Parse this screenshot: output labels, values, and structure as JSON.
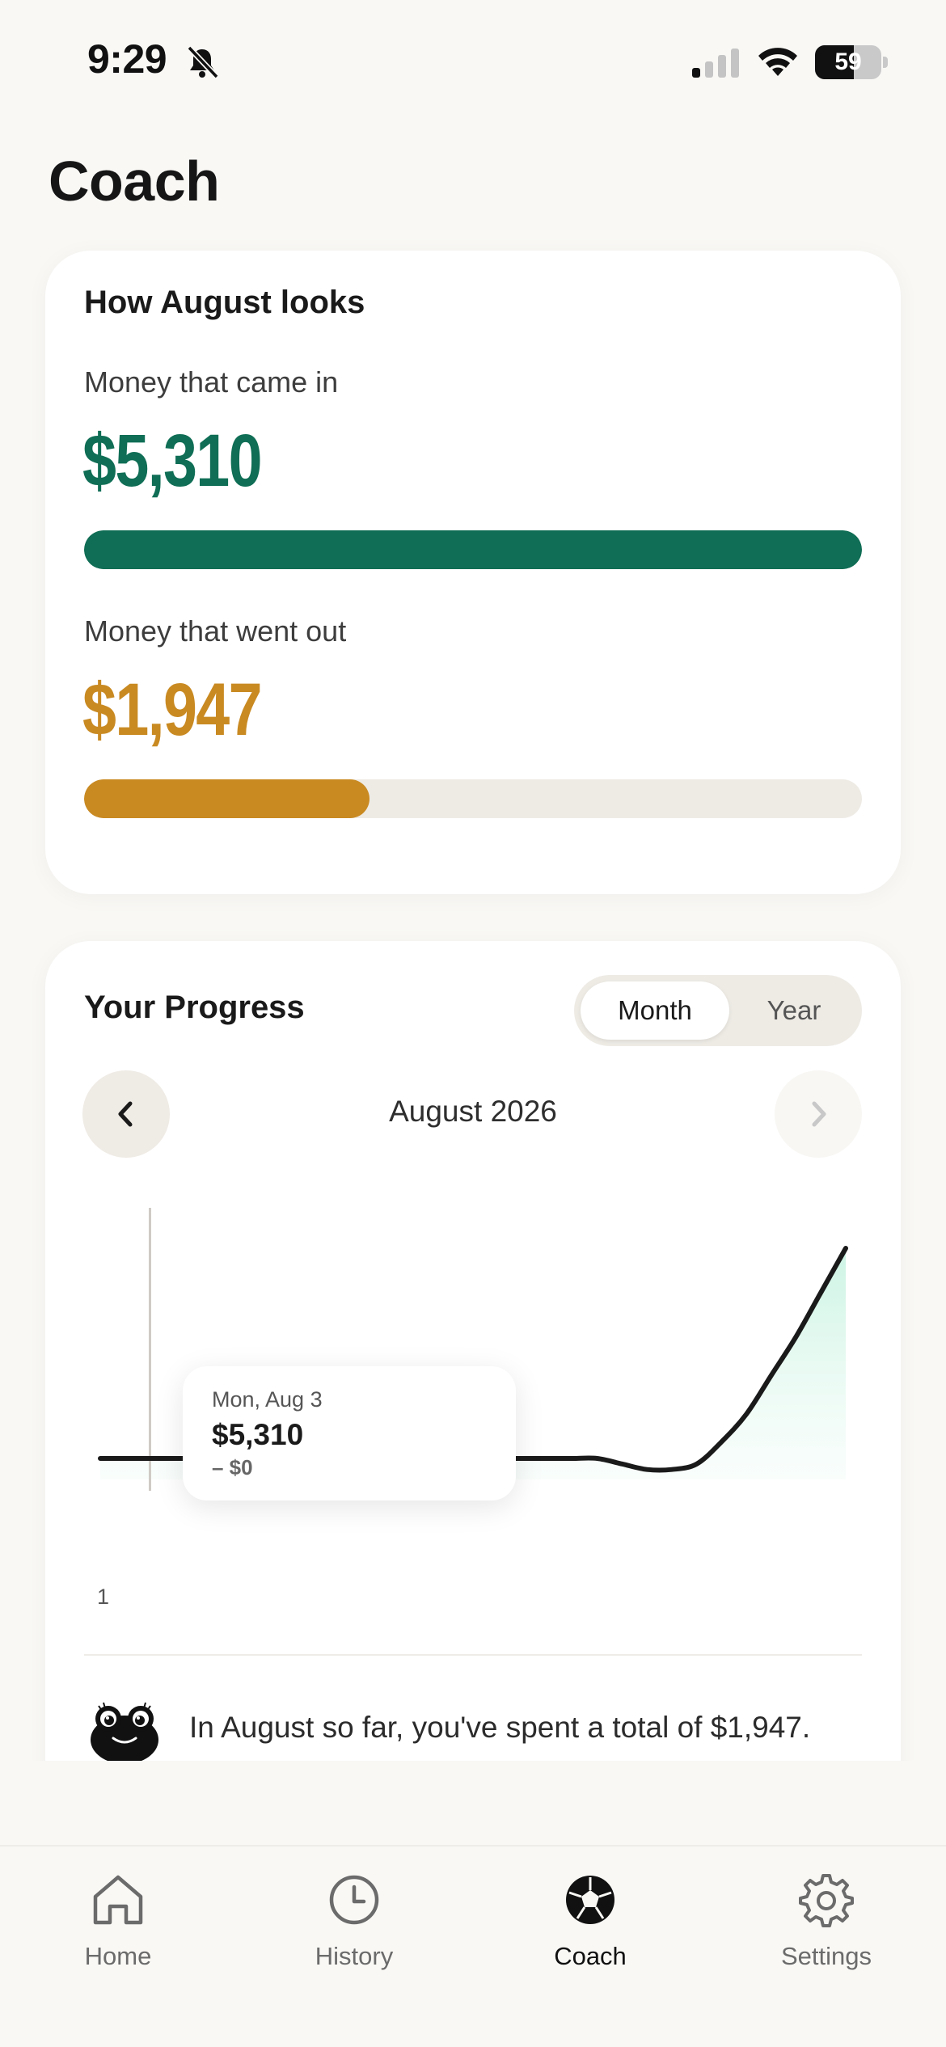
{
  "status_bar": {
    "time": "9:29",
    "battery": "59",
    "battery_level": 0.59,
    "icons": [
      "bell-slash-icon",
      "signal-icon",
      "wifi-icon",
      "battery-icon"
    ]
  },
  "page": {
    "title": "Coach"
  },
  "summary_card": {
    "title": "How August looks",
    "income": {
      "label": "Money that came in",
      "amount": "$5,310",
      "fill_fraction": 1.0,
      "color": "#0f6e55"
    },
    "spending": {
      "label": "Money that went out",
      "amount": "$1,947",
      "fill_fraction": 0.367,
      "color": "#c98a22"
    },
    "track_color": "#eeebe5"
  },
  "progress_card": {
    "title": "Your Progress",
    "segmented": {
      "options": [
        "Month",
        "Year"
      ],
      "selected": "Month"
    },
    "period": "August 2026",
    "prev_icon": "chevron-left-icon",
    "next_icon": "chevron-right-icon",
    "tooltip": {
      "date": "Mon, Aug 3",
      "value": "$5,310",
      "sub": "– $0"
    },
    "x_tick": "1",
    "message": "In August so far, you've spent a total of $1,947.",
    "mascot_icon": "frog-mascot-icon"
  },
  "chart_data": {
    "type": "line",
    "x": [
      1,
      2,
      3,
      4,
      5,
      6,
      7,
      8,
      9,
      10,
      11,
      12,
      13,
      14,
      15,
      16,
      17,
      18,
      19,
      20,
      21,
      22,
      23,
      24,
      25,
      26,
      27,
      28,
      29,
      30,
      31
    ],
    "series": [
      {
        "values": [
          0,
          0,
          0,
          0,
          0,
          0,
          0,
          0,
          0,
          0,
          0,
          0,
          0,
          0,
          0,
          0,
          0,
          0,
          0,
          0,
          0,
          -1,
          -2,
          -2,
          -1,
          3,
          8,
          15,
          22,
          30,
          38
        ]
      }
    ],
    "xlabel": "",
    "ylabel": "",
    "x_ticks": [
      "1"
    ],
    "highlight_x": 3,
    "grid": false,
    "line_color": "#1a1a1a",
    "area_color": "#d9f7ec"
  },
  "tab_bar": {
    "tabs": [
      {
        "label": "Home",
        "icon": "home-icon"
      },
      {
        "label": "History",
        "icon": "clock-icon"
      },
      {
        "label": "Coach",
        "icon": "coach-ball-icon"
      },
      {
        "label": "Settings",
        "icon": "gear-icon"
      }
    ],
    "active": "Coach"
  }
}
